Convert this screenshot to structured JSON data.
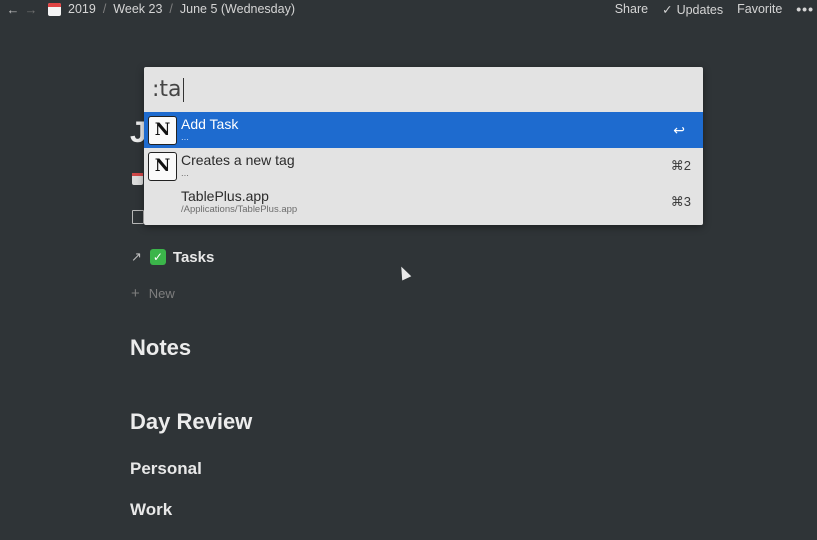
{
  "topbar": {
    "breadcrumbs": [
      "2019",
      "Week 23",
      "June 5 (Wednesday)"
    ],
    "separator": "/",
    "share_label": "Share",
    "updates_label": "Updates",
    "favorite_label": "Favorite",
    "more_glyph": "•••",
    "back_glyph": "←",
    "forward_glyph": "→",
    "check_glyph": "✓",
    "breadcrumb_icon": "calendar-icon"
  },
  "page": {
    "title_fragment": "J",
    "tasks_label": "Tasks",
    "link_glyph": "↗",
    "check_glyph": "✓",
    "new_label": "New",
    "plus_glyph": "+",
    "headings": {
      "notes": "Notes",
      "day_review": "Day Review",
      "personal": "Personal",
      "work": "Work"
    }
  },
  "launcher": {
    "query": ":ta",
    "results": [
      {
        "title": "Add Task",
        "subtitle": "...",
        "shortcut": "↩",
        "icon": "notion-icon",
        "selected": true
      },
      {
        "title": "Creates a new tag",
        "subtitle": "...",
        "shortcut": "⌘2",
        "icon": "notion-icon",
        "selected": false
      },
      {
        "title": "TablePlus.app",
        "subtitle": "/Applications/TablePlus.app",
        "shortcut": "⌘3",
        "icon": "none",
        "selected": false
      }
    ],
    "notion_glyph": "N"
  },
  "colors": {
    "background": "#2f3437",
    "selection": "#1e6bcf",
    "launcher_bg": "#e3e3e3",
    "tasks_check": "#3bb54a"
  }
}
